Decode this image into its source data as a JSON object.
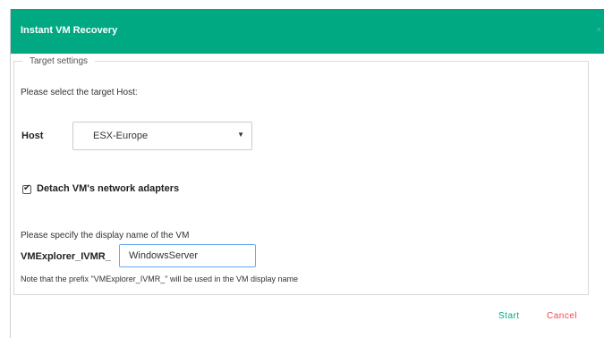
{
  "dialog": {
    "title": "Instant VM Recovery",
    "close_glyph": "×"
  },
  "target_settings": {
    "legend": "Target settings",
    "host_prompt": "Please select the target Host:",
    "host_label": "Host",
    "host_value": "ESX-Europe",
    "host_caret": "▼",
    "detach_checked": true,
    "detach_label": "Detach VM's network adapters",
    "name_prompt": "Please specify the display name of the VM",
    "name_prefix": "VMExplorer_IVMR_",
    "name_value": "WindowsServer",
    "note": "Note that the prefix \"VMExplorer_IVMR_\" will be used in the VM display name"
  },
  "actions": {
    "start_label": "Start",
    "cancel_label": "Cancel"
  },
  "colors": {
    "accent": "#01a982",
    "cancel": "#f04953",
    "focus_border": "#66aaee"
  },
  "icons": {
    "close": "close-icon",
    "dropdown": "chevron-down-icon",
    "checkbox": "checkmark-icon"
  }
}
